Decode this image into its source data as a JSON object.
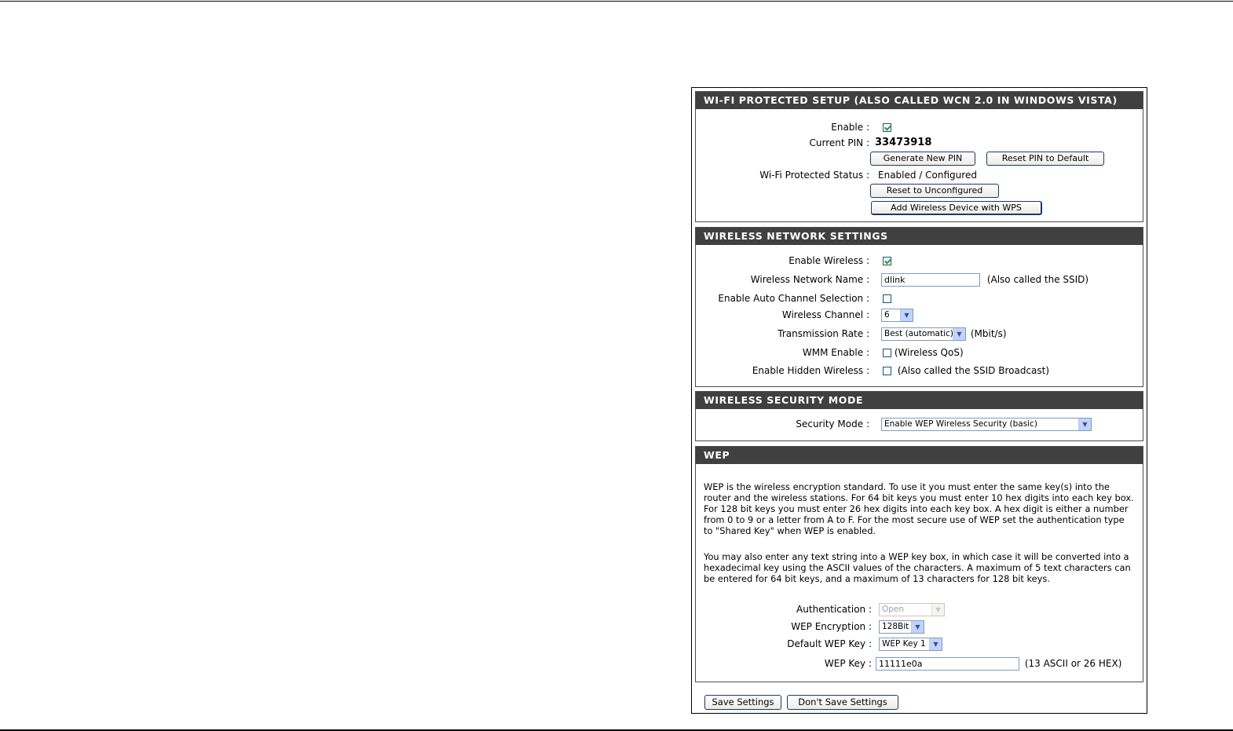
{
  "wps": {
    "header": "WI-FI PROTECTED SETUP (ALSO CALLED WCN 2.0 IN WINDOWS VISTA)",
    "enable_label": "Enable :",
    "enable_checked": true,
    "pin_label": "Current PIN :",
    "pin_value": "33473918",
    "generate_pin_button": "Generate New PIN",
    "reset_pin_button": "Reset PIN to Default",
    "status_label": "Wi-Fi Protected Status :",
    "status_value": "Enabled / Configured",
    "reset_unconfigured_button": "Reset to Unconfigured",
    "add_device_button": "Add Wireless Device with WPS"
  },
  "wireless": {
    "header": "WIRELESS NETWORK SETTINGS",
    "enable_wireless_label": "Enable Wireless :",
    "enable_wireless_checked": true,
    "network_name_label": "Wireless Network Name :",
    "network_name_value": "dlink",
    "network_name_note": "(Also called the SSID)",
    "auto_channel_label": "Enable Auto Channel Selection :",
    "auto_channel_checked": false,
    "channel_label": "Wireless Channel :",
    "channel_value": "6",
    "rate_label": "Transmission Rate :",
    "rate_value": "Best (automatic)",
    "rate_unit": "(Mbit/s)",
    "wmm_label": "WMM Enable :",
    "wmm_checked": false,
    "wmm_note": "(Wireless QoS)",
    "hidden_label": "Enable Hidden Wireless :",
    "hidden_checked": false,
    "hidden_note": "(Also called the SSID Broadcast)"
  },
  "security": {
    "header": "WIRELESS SECURITY MODE",
    "mode_label": "Security Mode :",
    "mode_value": "Enable WEP Wireless Security (basic)"
  },
  "wep": {
    "header": "WEP",
    "para1": "WEP is the wireless encryption standard. To use it you must enter the same key(s) into the router and the wireless stations. For 64 bit keys you must enter 10 hex digits into each key box. For 128 bit keys you must enter 26 hex digits into each key box. A hex digit is either a number from 0 to 9 or a letter from A to F. For the most secure use of WEP set the authentication type to \"Shared Key\" when WEP is enabled.",
    "para2": "You may also enter any text string into a WEP key box, in which case it will be converted into a hexadecimal key using the ASCII values of the characters. A maximum of 5 text characters can be entered for 64 bit keys, and a maximum of 13 characters for 128 bit keys.",
    "auth_label": "Authentication :",
    "auth_value": "Open",
    "encryption_label": "WEP Encryption :",
    "encryption_value": "128Bit",
    "default_key_label": "Default WEP Key :",
    "default_key_value": "WEP Key 1",
    "key_label": "WEP Key :",
    "key_value": "11111e0a",
    "key_note": "(13 ASCII or 26 HEX)"
  },
  "footer": {
    "save_button": "Save Settings",
    "dont_save_button": "Don't Save Settings"
  }
}
